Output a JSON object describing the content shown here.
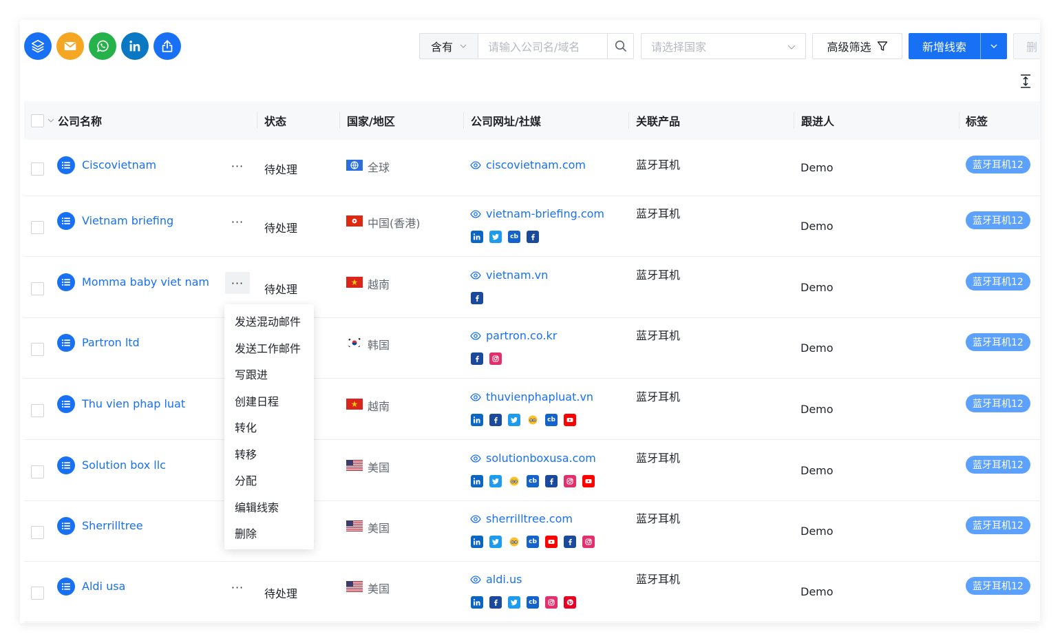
{
  "toolbar": {
    "contains_select": "含有",
    "search_placeholder": "请输入公司名/域名",
    "country_placeholder": "请选择国家",
    "advanced_filter": "高级筛选",
    "new_lead": "新增线索",
    "delete": "删"
  },
  "quick_icons": [
    {
      "name": "layers-icon",
      "color": "#1870f5"
    },
    {
      "name": "mail-icon",
      "color": "#f5a623"
    },
    {
      "name": "whatsapp-icon",
      "color": "#25b24a"
    },
    {
      "name": "linkedin-icon",
      "color": "#0a78c2"
    },
    {
      "name": "export-icon",
      "color": "#1870f5"
    }
  ],
  "table": {
    "headers": {
      "company": "公司名称",
      "status": "状态",
      "country": "国家/地区",
      "website": "公司网址/社媒",
      "product": "关联产品",
      "follower": "跟进人",
      "tag": "标签"
    },
    "rows": [
      {
        "company": "Ciscovietnam",
        "status": "待处理",
        "flag": "globe",
        "country": "全球",
        "website": "ciscovietnam.com",
        "socials": [],
        "product": "蓝牙耳机",
        "follower": "Demo",
        "tag": "蓝牙耳机12"
      },
      {
        "company": "Vietnam briefing",
        "status": "待处理",
        "flag": "hk",
        "country": "中国(香港)",
        "website": "vietnam-briefing.com",
        "socials": [
          "linkedin",
          "twitter",
          "crunchbase",
          "facebook"
        ],
        "product": "蓝牙耳机",
        "follower": "Demo",
        "tag": "蓝牙耳机12"
      },
      {
        "company": "Momma baby viet nam",
        "status": "待处理",
        "flag": "vn",
        "country": "越南",
        "website": "vietnam.vn",
        "socials": [
          "facebook"
        ],
        "product": "蓝牙耳机",
        "follower": "Demo",
        "tag": "蓝牙耳机12"
      },
      {
        "company": "Partron ltd",
        "status": "",
        "flag": "kr",
        "country": "韩国",
        "website": "partron.co.kr",
        "socials": [
          "facebook",
          "instagram"
        ],
        "product": "蓝牙耳机",
        "follower": "Demo",
        "tag": "蓝牙耳机12"
      },
      {
        "company": "Thu vien phap luat",
        "status": "",
        "flag": "vn",
        "country": "越南",
        "website": "thuvienphapluat.vn",
        "socials": [
          "linkedin",
          "facebook",
          "twitter",
          "tripadvisor",
          "crunchbase",
          "youtube"
        ],
        "product": "蓝牙耳机",
        "follower": "Demo",
        "tag": "蓝牙耳机12"
      },
      {
        "company": "Solution box llc",
        "status": "",
        "flag": "us",
        "country": "美国",
        "website": "solutionboxusa.com",
        "socials": [
          "linkedin",
          "twitter",
          "tripadvisor",
          "crunchbase",
          "facebook",
          "instagram",
          "youtube"
        ],
        "product": "蓝牙耳机",
        "follower": "Demo",
        "tag": "蓝牙耳机12"
      },
      {
        "company": "Sherrilltree",
        "status": "",
        "flag": "us",
        "country": "美国",
        "website": "sherrilltree.com",
        "socials": [
          "linkedin",
          "twitter",
          "tripadvisor",
          "crunchbase",
          "youtube",
          "facebook",
          "instagram"
        ],
        "product": "蓝牙耳机",
        "follower": "Demo",
        "tag": "蓝牙耳机12"
      },
      {
        "company": "Aldi usa",
        "status": "待处理",
        "flag": "us",
        "country": "美国",
        "website": "aldi.us",
        "socials": [
          "linkedin",
          "facebook",
          "twitter",
          "crunchbase",
          "instagram",
          "pinterest"
        ],
        "product": "蓝牙耳机",
        "follower": "Demo",
        "tag": "蓝牙耳机12"
      }
    ]
  },
  "row_menu": {
    "items": [
      "发送混动邮件",
      "发送工作邮件",
      "写跟进",
      "创建日程",
      "转化",
      "转移",
      "分配",
      "编辑线索",
      "删除"
    ]
  },
  "colors": {
    "primary": "#1870f5",
    "tag_bg": "#5da1ff"
  }
}
